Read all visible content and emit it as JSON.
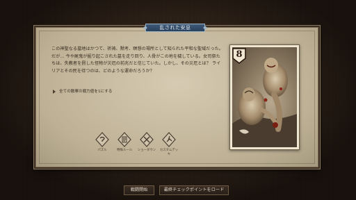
{
  "event": {
    "title": "乱された安息",
    "story": "この神聖なる墓地はかつて、祈祷、黙考、瞑想の場所として知られた平和な聖域だった。だが… 今や屍鬼が掘り起こされた墓を走り回り、人骨がこの地を穢している。女司祭たちは、失教者を罰した怪物が災厄の前兆だと信じていた。しかし、その災厄とは？ ライリアとその民を待つのは、どのような運命だろうか？",
    "option": "全ての敵軍の戦力値を1にする"
  },
  "mode_icons": [
    {
      "name": "puzzle",
      "label": "パズル"
    },
    {
      "name": "special-rule",
      "label": "特殊ルール"
    },
    {
      "name": "showdown",
      "label": "ショーダウン"
    },
    {
      "name": "custom-deck",
      "label": "カスタムデッキ"
    }
  ],
  "card": {
    "strength": "8"
  },
  "buttons": {
    "start": "戦闘開始",
    "load": "最終チェックポイントをロード"
  },
  "colors": {
    "parchment": "#c9bda2",
    "title_badge": "#324a66",
    "text": "#3a2e22"
  }
}
